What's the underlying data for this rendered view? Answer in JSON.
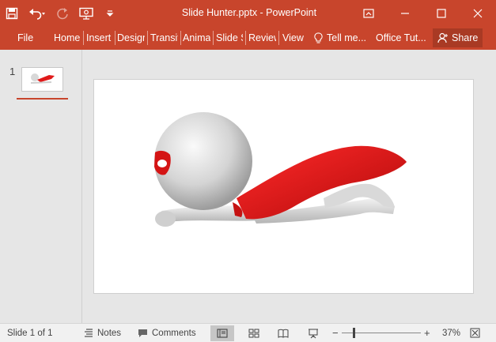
{
  "window": {
    "title": "Slide Hunter.pptx - PowerPoint"
  },
  "ribbon": {
    "file": "File",
    "tabs": [
      "Home",
      "Insert",
      "Design",
      "Transitions",
      "Animations",
      "Slide Show",
      "Review",
      "View"
    ],
    "tell_me": "Tell me...",
    "account": "Office Tut...",
    "share": "Share"
  },
  "thumbnails": [
    {
      "number": "1"
    }
  ],
  "status": {
    "slide_info": "Slide 1 of 1",
    "notes": "Notes",
    "comments": "Comments",
    "zoom_minus": "−",
    "zoom_plus": "+",
    "zoom_level": "37%"
  },
  "colors": {
    "accent": "#c8452c",
    "cape": "#e01a1a"
  }
}
